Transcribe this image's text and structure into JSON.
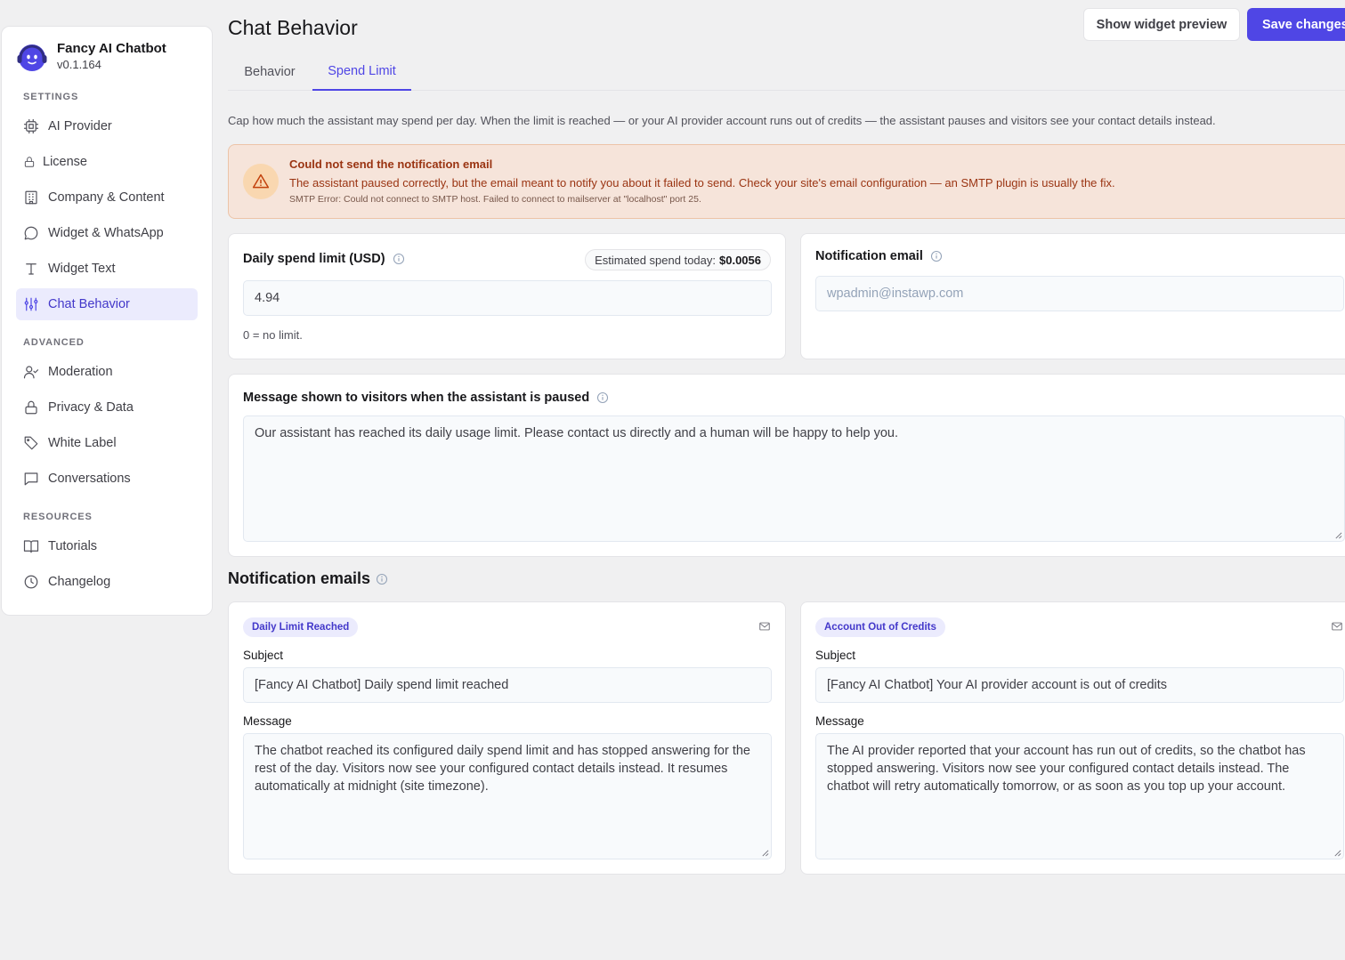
{
  "app": {
    "name": "Fancy AI Chatbot",
    "version": "v0.1.164"
  },
  "sidebar": {
    "sections": [
      {
        "label": "SETTINGS",
        "items": [
          {
            "label": "AI Provider",
            "icon": "chip-icon"
          },
          {
            "label": "License",
            "icon": "lock-icon"
          },
          {
            "label": "Company & Content",
            "icon": "building-icon"
          },
          {
            "label": "Widget & WhatsApp",
            "icon": "chat-bubble-icon"
          },
          {
            "label": "Widget Text",
            "icon": "text-icon"
          },
          {
            "label": "Chat Behavior",
            "icon": "sliders-icon",
            "active": true
          }
        ]
      },
      {
        "label": "ADVANCED",
        "items": [
          {
            "label": "Moderation",
            "icon": "user-check-icon"
          },
          {
            "label": "Privacy & Data",
            "icon": "padlock-icon"
          },
          {
            "label": "White Label",
            "icon": "tag-icon"
          },
          {
            "label": "Conversations",
            "icon": "message-square-icon"
          }
        ]
      },
      {
        "label": "RESOURCES",
        "items": [
          {
            "label": "Tutorials",
            "icon": "book-icon"
          },
          {
            "label": "Changelog",
            "icon": "clock-icon"
          }
        ]
      }
    ]
  },
  "header": {
    "title": "Chat Behavior",
    "preview_button": "Show widget preview",
    "save_button": "Save changes"
  },
  "tabs": [
    {
      "label": "Behavior",
      "active": false
    },
    {
      "label": "Spend Limit",
      "active": true
    }
  ],
  "intro": "Cap how much the assistant may spend per day. When the limit is reached — or your AI provider account runs out of credits — the assistant pauses and visitors see your contact details instead.",
  "alert": {
    "title": "Could not send the notification email",
    "body": "The assistant paused correctly, but the email meant to notify you about it failed to send. Check your site's email configuration — an SMTP plugin is usually the fix.",
    "detail": "SMTP Error: Could not connect to SMTP host. Failed to connect to mailserver at \"localhost\" port 25.",
    "color": "#9a3412"
  },
  "daily_limit": {
    "label": "Daily spend limit (USD)",
    "estimate_label": "Estimated spend today:",
    "estimate_value": "$0.0056",
    "value": "4.94",
    "hint": "0 = no limit."
  },
  "notification_email": {
    "label": "Notification email",
    "placeholder": "wpadmin@instawp.com"
  },
  "paused_message": {
    "label": "Message shown to visitors when the assistant is paused",
    "value": "Our assistant has reached its daily usage limit. Please contact us directly and a human will be happy to help you."
  },
  "notification_emails": {
    "title": "Notification emails",
    "cards": [
      {
        "badge": "Daily Limit Reached",
        "subject_label": "Subject",
        "subject": "[Fancy AI Chatbot] Daily spend limit reached",
        "message_label": "Message",
        "message": "The chatbot reached its configured daily spend limit and has stopped answering for the rest of the day. Visitors now see your configured contact details instead. It resumes automatically at midnight (site timezone)."
      },
      {
        "badge": "Account Out of Credits",
        "subject_label": "Subject",
        "subject": "[Fancy AI Chatbot] Your AI provider account is out of credits",
        "message_label": "Message",
        "message": "The AI provider reported that your account has run out of credits, so the chatbot has stopped answering. Visitors now see your configured contact details instead. The chatbot will retry automatically tomorrow, or as soon as you top up your account."
      }
    ]
  },
  "colors": {
    "accent": "#4f46e5",
    "active_bg": "#ebebfd",
    "alert_bg": "#f6e4da"
  }
}
